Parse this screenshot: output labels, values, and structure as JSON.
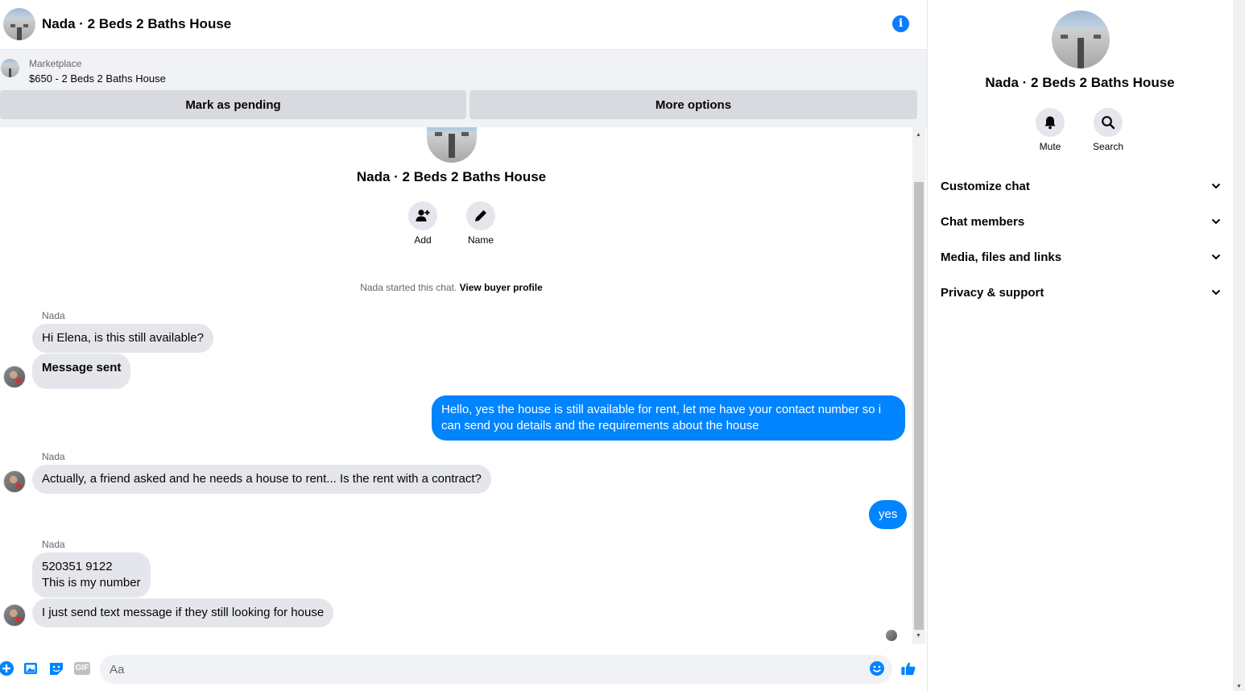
{
  "header": {
    "title": "Nada · 2 Beds 2 Baths House",
    "info_icon": "info-icon"
  },
  "listing": {
    "label": "Marketplace",
    "price_title": "$650 - 2 Beds 2 Baths House",
    "mark_pending": "Mark as pending",
    "more_options": "More options"
  },
  "thread": {
    "title": "Nada · 2 Beds 2 Baths House",
    "add_label": "Add",
    "name_label": "Name",
    "started_text": "Nada started this chat.",
    "view_profile": "View buyer profile",
    "messages": [
      {
        "sender": "Nada",
        "text": "Hi Elena, is this still available?"
      },
      {
        "text": "Message sent"
      },
      {
        "text": "Hello, yes the house is still available for rent, let me have your contact number so i can send you details and the requirements about the house",
        "outgoing": true
      },
      {
        "sender": "Nada",
        "text": "Actually, a friend asked and he needs a house to rent... Is the rent with a contract?"
      },
      {
        "text": "yes",
        "outgoing": true
      },
      {
        "sender": "Nada",
        "text": "520351 9122\nThis is my number"
      },
      {
        "text": "I just send text message if they still looking for house"
      }
    ]
  },
  "composer": {
    "placeholder": "Aa",
    "icons": [
      "plus-icon",
      "photo-icon",
      "sticker-icon",
      "gif-icon",
      "emoji-icon",
      "like-icon"
    ],
    "gif_label": "GIF"
  },
  "sidebar": {
    "title": "Nada · 2 Beds 2 Baths House",
    "mute_label": "Mute",
    "search_label": "Search",
    "sections": [
      "Customize chat",
      "Chat members",
      "Media, files and links",
      "Privacy & support"
    ]
  },
  "colors": {
    "accent": "#0084ff",
    "incoming_bubble": "#e4e6eb",
    "banner_bg": "#f0f2f5",
    "button_bg": "#d8dadf"
  }
}
